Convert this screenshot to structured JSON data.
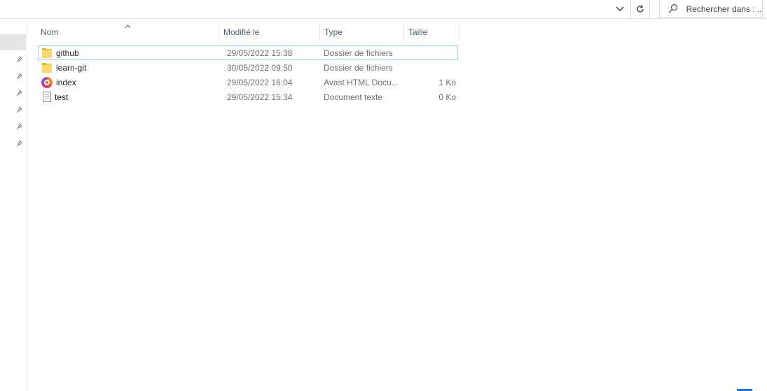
{
  "toolbar": {
    "search_placeholder": "Rechercher dans : ..."
  },
  "columns": {
    "name": "Nom",
    "modified": "Modifié le",
    "type": "Type",
    "size": "Taille"
  },
  "files": [
    {
      "name": "github",
      "modified": "29/05/2022 15:38",
      "type": "Dossier de fichiers",
      "size": "",
      "icon": "folder-icon"
    },
    {
      "name": "learn-git",
      "modified": "30/05/2022 09:50",
      "type": "Dossier de fichiers",
      "size": "",
      "icon": "folder-icon"
    },
    {
      "name": "index",
      "modified": "29/05/2022 16:04",
      "type": "Avast HTML Docu...",
      "size": "1 Ko",
      "icon": "avast-browser-icon"
    },
    {
      "name": "test",
      "modified": "29/05/2022 15:34",
      "type": "Document texte",
      "size": "0 Ko",
      "icon": "text-document-icon"
    }
  ],
  "colors": {
    "header_text": "#4c607a",
    "focus_border": "#99d1ff",
    "folder": "#ffd86b"
  }
}
